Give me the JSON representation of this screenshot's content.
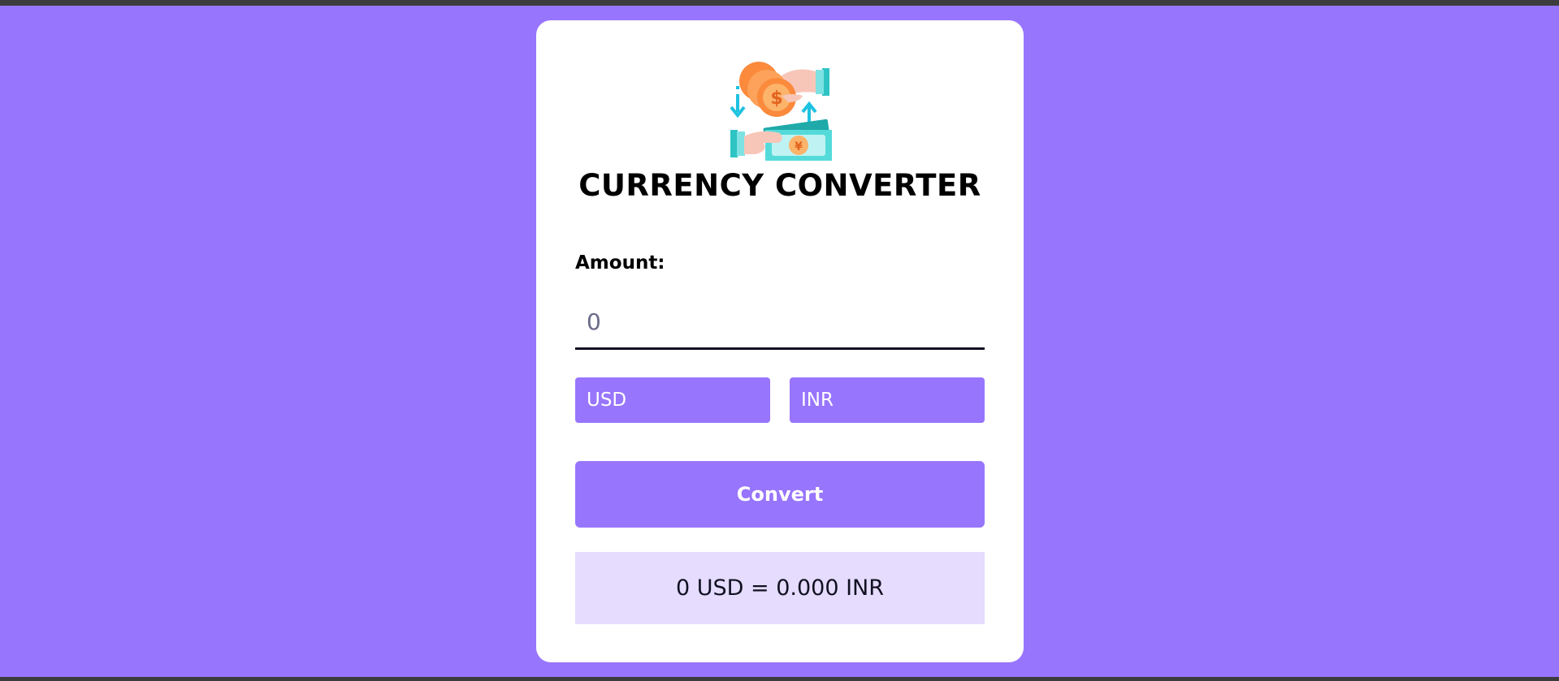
{
  "app": {
    "title": "CURRENCY CONVERTER",
    "logo_icon": "currency-exchange-icon"
  },
  "form": {
    "amount_label": "Amount:",
    "amount_value": "0",
    "from_currency": "USD",
    "to_currency": "INR",
    "convert_label": "Convert",
    "result_text": "0 USD = 0.000 INR"
  },
  "colors": {
    "background": "#9875fd",
    "card": "#ffffff",
    "accent": "#9875fd",
    "result_bg": "#e5dcfe"
  }
}
